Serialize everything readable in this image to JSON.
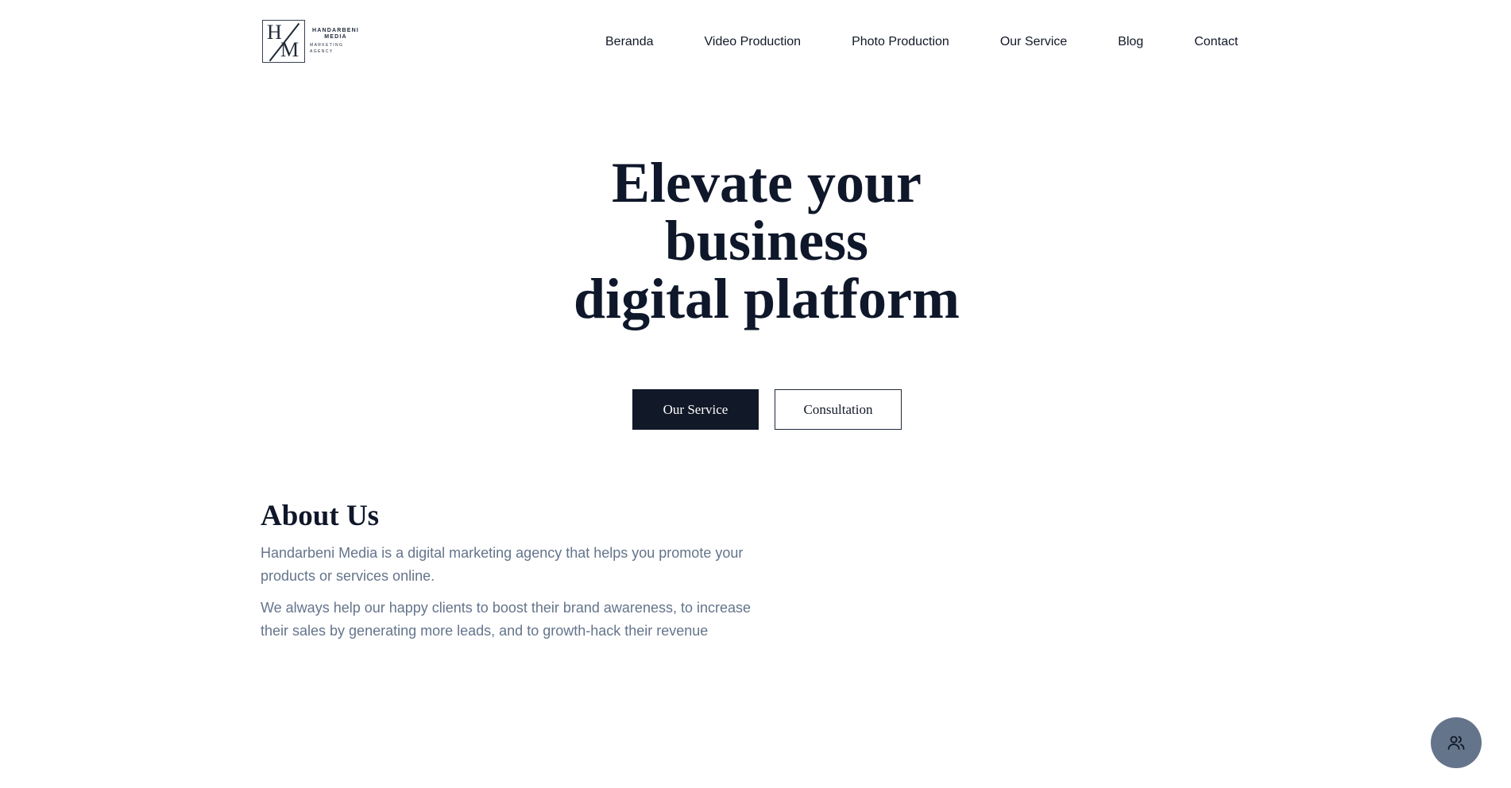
{
  "header": {
    "logo": {
      "mark_left": "H",
      "mark_right": "M",
      "line1": "HANDARBENI",
      "line2": "MEDIA",
      "line3": "MARKETING AGENCY"
    },
    "nav": [
      {
        "label": "Beranda"
      },
      {
        "label": "Video Production"
      },
      {
        "label": "Photo Production"
      },
      {
        "label": "Our Service"
      },
      {
        "label": "Blog"
      },
      {
        "label": "Contact"
      }
    ]
  },
  "hero": {
    "title_line1": "Elevate your",
    "title_line2": "business",
    "title_line3": "digital platform",
    "primary_button": "Our Service",
    "secondary_button": "Consultation"
  },
  "about": {
    "title": "About Us",
    "paragraph1": "Handarbeni Media is a digital marketing agency that helps you promote your products or services online.",
    "paragraph2": "We always help our happy clients to boost their brand awareness, to increase their sales by generating more leads, and to growth-hack their revenue"
  },
  "floating_button": {
    "icon": "users-icon"
  },
  "colors": {
    "primary_dark": "#111827",
    "heading": "#0f172a",
    "body_text": "#64748b",
    "fab_background": "#64748b",
    "background": "#ffffff"
  }
}
